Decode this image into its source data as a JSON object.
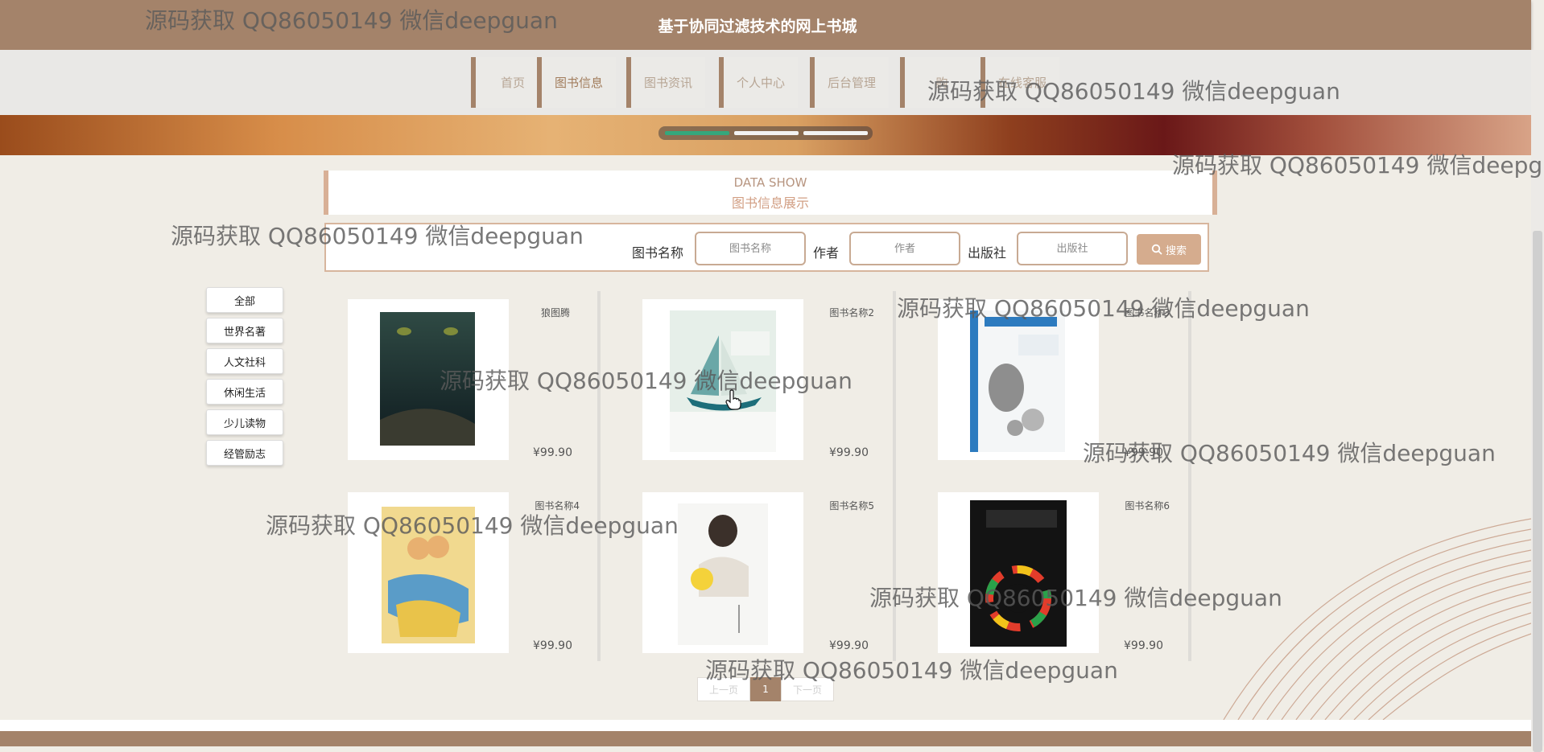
{
  "site": {
    "title": "基于协同过滤技术的网上书城"
  },
  "nav": [
    {
      "label": "首页"
    },
    {
      "label": "图书信息"
    },
    {
      "label": "图书资讯"
    },
    {
      "label": "个人中心"
    },
    {
      "label": "后台管理"
    },
    {
      "label": "购"
    },
    {
      "label": "在线客服"
    }
  ],
  "section": {
    "title_en": "DATA SHOW",
    "title_cn": "图书信息展示"
  },
  "search": {
    "name_label": "图书名称",
    "name_placeholder": "图书名称",
    "author_label": "作者",
    "author_placeholder": "作者",
    "publisher_label": "出版社",
    "publisher_placeholder": "出版社",
    "button_label": "搜索",
    "button_icon": "search-icon"
  },
  "categories": [
    "全部",
    "世界名著",
    "人文社科",
    "休闲生活",
    "少儿读物",
    "经管励志"
  ],
  "books": [
    {
      "name": "狼图腾",
      "price": "¥99.90"
    },
    {
      "name": "图书名称2",
      "price": "¥99.90"
    },
    {
      "name": "图书名称3",
      "price": "¥99.90"
    },
    {
      "name": "图书名称4",
      "price": "¥99.90"
    },
    {
      "name": "图书名称5",
      "price": "¥99.90"
    },
    {
      "name": "图书名称6",
      "price": "¥99.90"
    }
  ],
  "pagination": {
    "prev": "上一页",
    "current": "1",
    "next": "下一页"
  },
  "watermark": "源码获取 QQ86050149 微信deepguan",
  "colors": {
    "brand": "#a4836a",
    "accent": "#d5ac8e",
    "slider_active": "#35a77c"
  }
}
